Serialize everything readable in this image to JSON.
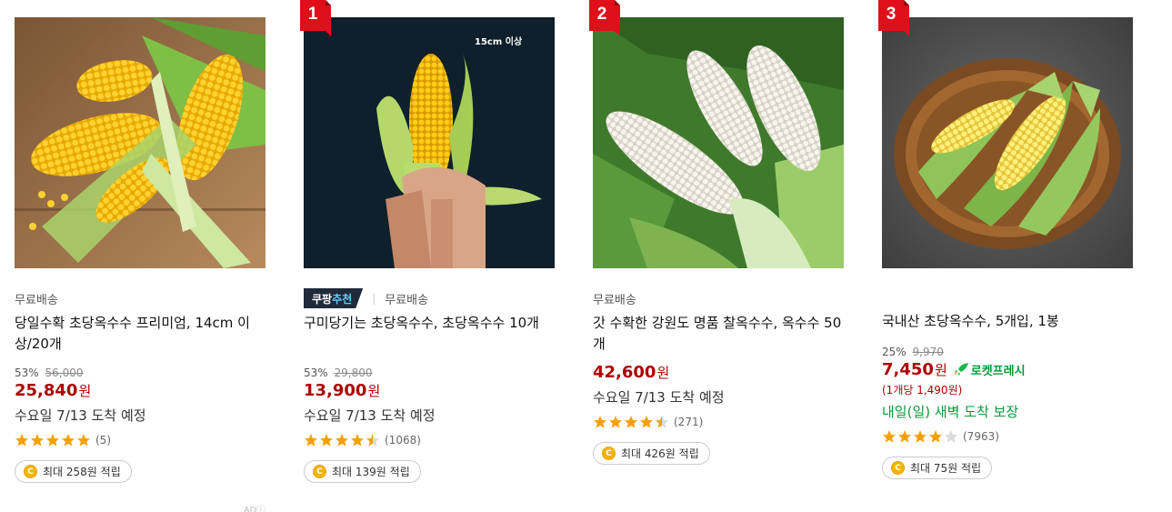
{
  "products": [
    {
      "rank": "",
      "badge": null,
      "shipping": "무료배송",
      "title": "당일수확 초당옥수수 프리미엄, 14cm 이상/20개",
      "discount": "53%",
      "original_price": "56,000",
      "price": "25,840",
      "currency": "원",
      "unit_price": "",
      "rocket": "",
      "delivery": "수요일 7/13 도착 예정",
      "delivery_green": false,
      "rating": 5,
      "review_count": "(5)",
      "cashback": "최대 258원 적립"
    },
    {
      "rank": "1",
      "badge": {
        "part1": "쿠팡",
        "part2": "추천"
      },
      "shipping": "무료배송",
      "title": "구미당기는 초당옥수수, 초당옥수수 10개",
      "image_caption": "15cm 이상",
      "discount": "53%",
      "original_price": "29,800",
      "price": "13,900",
      "currency": "원",
      "unit_price": "",
      "rocket": "",
      "delivery": "수요일 7/13 도착 예정",
      "delivery_green": false,
      "rating": 4.5,
      "review_count": "(1068)",
      "cashback": "최대 139원 적립"
    },
    {
      "rank": "2",
      "badge": null,
      "shipping": "무료배송",
      "title": "갓 수확한 강원도 명품 찰옥수수, 옥수수 50개",
      "discount": "",
      "original_price": "",
      "price": "42,600",
      "currency": "원",
      "unit_price": "",
      "rocket": "",
      "delivery": "수요일 7/13 도착 예정",
      "delivery_green": false,
      "rating": 4.5,
      "review_count": "(271)",
      "cashback": "최대 426원 적립"
    },
    {
      "rank": "3",
      "badge": null,
      "shipping": "",
      "title": "국내산 초당옥수수, 5개입, 1봉",
      "discount": "25%",
      "original_price": "9,970",
      "price": "7,450",
      "currency": "원",
      "unit_price": "(1개당 1,490원)",
      "rocket": "로켓프레시",
      "delivery": "내일(일) 새벽 도착 보장",
      "delivery_green": true,
      "rating": 4,
      "review_count": "(7963)",
      "cashback": "최대 75원 적립"
    }
  ],
  "ad_label": "AD",
  "colors": {
    "price": "#ae0000",
    "star": "#f5a000",
    "rank_red": "#e0101a",
    "rocket_green": "#0a9a3a",
    "badge_bg": "#1f2a3a"
  }
}
